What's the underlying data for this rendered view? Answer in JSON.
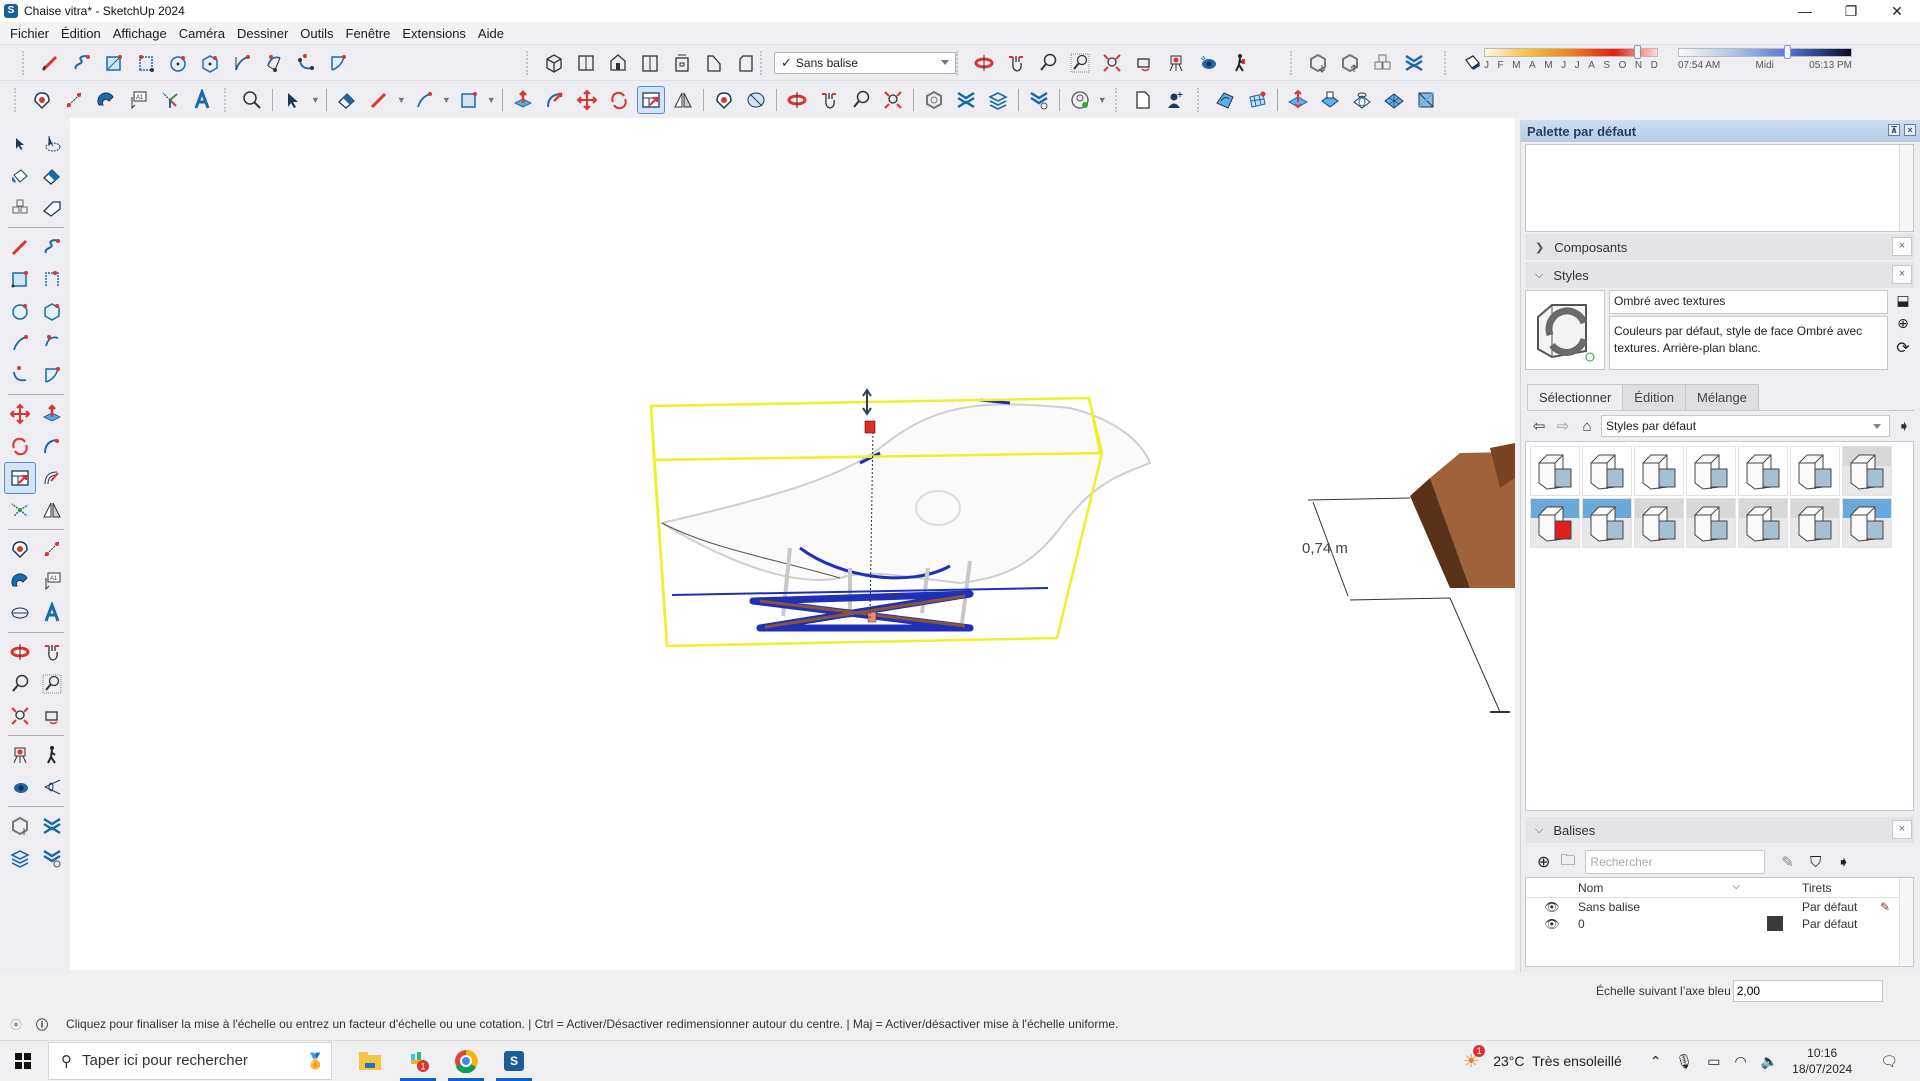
{
  "window": {
    "title": "Chaise vitra* - SketchUp 2024",
    "controls": {
      "minimize": "—",
      "restore": "❐",
      "close": "✕"
    }
  },
  "menu": [
    "Fichier",
    "Édition",
    "Affichage",
    "Caméra",
    "Dessiner",
    "Outils",
    "Fenêtre",
    "Extensions",
    "Aide"
  ],
  "toolbar": {
    "tag_select": {
      "checked": "✓",
      "value": "Sans balise"
    },
    "shadow": {
      "months": [
        "J",
        "F",
        "M",
        "A",
        "M",
        "J",
        "J",
        "A",
        "S",
        "O",
        "N",
        "D"
      ],
      "month_position": 0.86,
      "time_labels": [
        "07:54 AM",
        "Midi",
        "05:13 PM"
      ],
      "time_position": 0.61
    }
  },
  "canvas": {
    "dimension_label": "0,74 m",
    "colors": {
      "selection_box": "#f2ee2a",
      "selected_edges": "#1f2fb8",
      "wood": "#8a5535",
      "grip": "#d93025"
    }
  },
  "tray": {
    "title": "Palette par défaut",
    "sections": {
      "components": {
        "label": "Composants",
        "close": "×"
      },
      "styles": {
        "label": "Styles",
        "close": "×",
        "name": "Ombré avec textures",
        "description": "Couleurs par défaut, style de face Ombré avec textures. Arrière-plan blanc.",
        "tabs": [
          "Sélectionner",
          "Édition",
          "Mélange"
        ],
        "active_tab": "Sélectionner",
        "collection": "Styles par défaut",
        "thumbnail_count": 14
      },
      "tags": {
        "label": "Balises",
        "close": "×",
        "search_placeholder": "Rechercher",
        "columns": {
          "name": "Nom",
          "dashes": "Tirets"
        },
        "rows": [
          {
            "name": "Sans balise",
            "dashes": "Par défaut",
            "visible": true,
            "active": true
          },
          {
            "name": "0",
            "dashes": "Par défaut",
            "visible": true,
            "color": "#3a3a3a"
          }
        ]
      }
    }
  },
  "measurements": {
    "label": "Échelle suivant l’axe bleu",
    "value": "2,00"
  },
  "status": {
    "message": "Cliquez pour finaliser la mise à l'échelle ou entrez un facteur d'échelle ou une cotation. | Ctrl = Activer/Désactiver redimensionner autour du centre. | Maj = Activer/désactiver mise à l'échelle uniforme."
  },
  "taskbar": {
    "search_placeholder": "Taper ici pour rechercher",
    "weather": "23°C  Très ensoleillé",
    "weather_badge": "1",
    "slack_badge": "1",
    "time": "10:16",
    "date": "18/07/2024"
  }
}
